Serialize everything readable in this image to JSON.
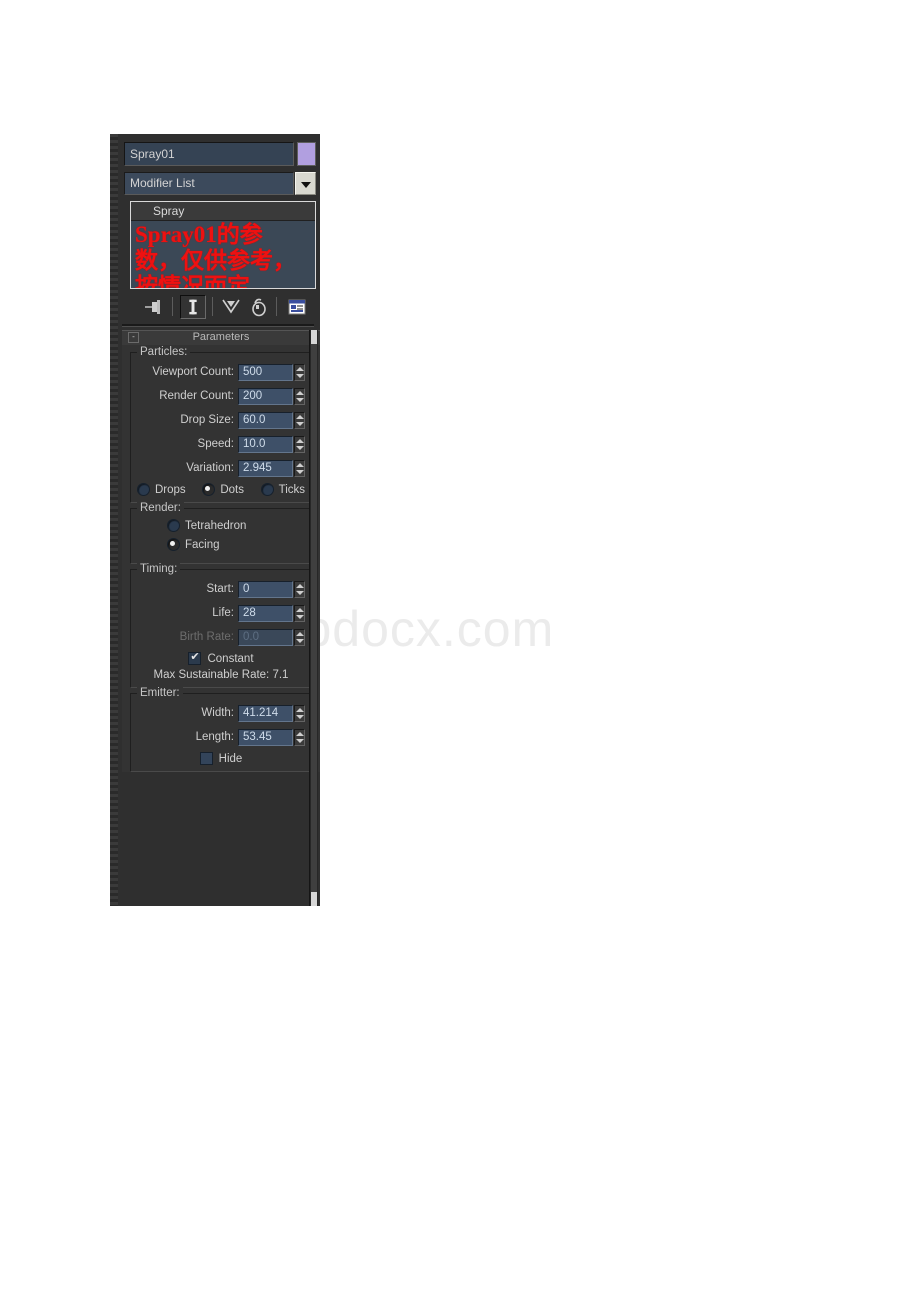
{
  "watermark": {
    "text": "www.bdocx.com"
  },
  "panel": {
    "object_name": "Spray01",
    "color_swatch": "#b19fe0",
    "modifier_list_label": "Modifier List",
    "modifier_stack": [
      {
        "label": "Spray"
      }
    ],
    "annotation": {
      "line1": "Spray01的参",
      "line2": "数，仅供参考，",
      "line3": "按情况而定。",
      "color": "#ee1111"
    },
    "stack_toolbar": [
      {
        "icon": "pin-stack-icon",
        "pressed": false
      },
      {
        "icon": "show-end-result-icon",
        "pressed": true
      },
      {
        "icon": "make-unique-icon",
        "pressed": false
      },
      {
        "icon": "remove-modifier-icon",
        "pressed": false
      },
      {
        "icon": "configure-sets-icon",
        "pressed": false
      }
    ],
    "rollout": {
      "title": "Parameters",
      "collapse_glyph": "-",
      "groups": {
        "particles": {
          "label": "Particles:",
          "fields": [
            {
              "label": "Viewport Count:",
              "value": "500",
              "disabled": false
            },
            {
              "label": "Render Count:",
              "value": "200",
              "disabled": false
            },
            {
              "label": "Drop Size:",
              "value": "60.0",
              "disabled": false
            },
            {
              "label": "Speed:",
              "value": "10.0",
              "disabled": false
            },
            {
              "label": "Variation:",
              "value": "2.945",
              "disabled": false
            }
          ],
          "radios": [
            {
              "label": "Drops",
              "selected": false
            },
            {
              "label": "Dots",
              "selected": true
            },
            {
              "label": "Ticks",
              "selected": false
            }
          ]
        },
        "render": {
          "label": "Render:",
          "radios": [
            {
              "label": "Tetrahedron",
              "selected": false
            },
            {
              "label": "Facing",
              "selected": true
            }
          ]
        },
        "timing": {
          "label": "Timing:",
          "fields": [
            {
              "label": "Start:",
              "value": "0",
              "disabled": false
            },
            {
              "label": "Life:",
              "value": "28",
              "disabled": false
            },
            {
              "label": "Birth Rate:",
              "value": "0.0",
              "disabled": true
            }
          ],
          "checkbox": {
            "label": "Constant",
            "checked": true
          },
          "status": "Max Sustainable Rate: 7.1"
        },
        "emitter": {
          "label": "Emitter:",
          "fields": [
            {
              "label": "Width:",
              "value": "41.214",
              "disabled": false
            },
            {
              "label": "Length:",
              "value": "53.45",
              "disabled": false
            }
          ],
          "checkbox": {
            "label": "Hide",
            "checked": false
          }
        }
      }
    }
  }
}
